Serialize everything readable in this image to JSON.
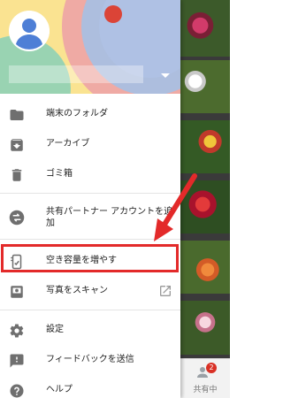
{
  "drawer": {
    "menu": [
      {
        "id": "device-folders",
        "label": "端末のフォルダ",
        "icon": "folder-icon"
      },
      {
        "id": "archive",
        "label": "アーカイブ",
        "icon": "archive-icon"
      },
      {
        "id": "trash",
        "label": "ゴミ箱",
        "icon": "trash-icon"
      },
      {
        "id": "partner-share",
        "label": "共有パートナー アカウントを追加",
        "icon": "swap-icon"
      },
      {
        "id": "free-up-space",
        "label": "空き容量を増やす",
        "icon": "phone-clean-icon"
      },
      {
        "id": "photo-scan",
        "label": "写真をスキャン",
        "icon": "photoscan-icon"
      },
      {
        "id": "settings",
        "label": "設定",
        "icon": "gear-icon"
      },
      {
        "id": "feedback",
        "label": "フィードバックを送信",
        "icon": "feedback-icon"
      },
      {
        "id": "help",
        "label": "ヘルプ",
        "icon": "help-icon"
      }
    ]
  },
  "bottom_tab": {
    "label": "共有中",
    "badge": "2"
  },
  "colors": {
    "highlight": "#e32a2a",
    "icon": "#6f6f6f"
  }
}
